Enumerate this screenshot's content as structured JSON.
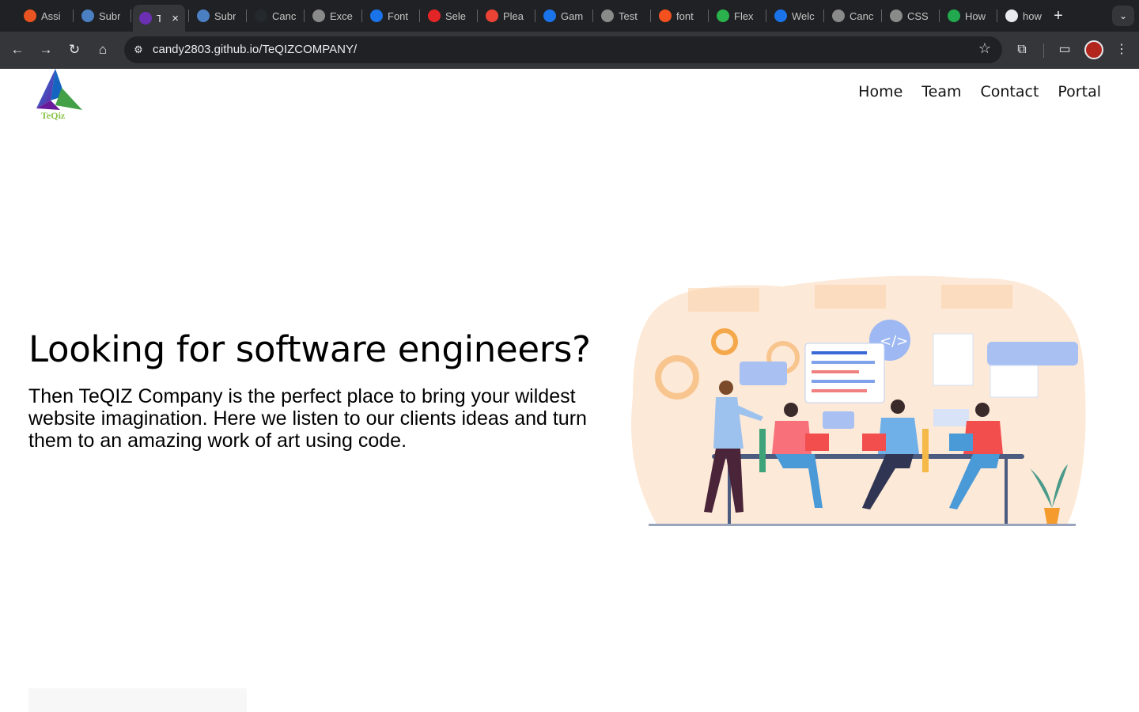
{
  "browser": {
    "tabs": [
      {
        "label": "Assi",
        "icon": "ubuntu-icon",
        "color": "#e95420"
      },
      {
        "label": "Subr",
        "icon": "e-icon",
        "color": "#4a7fc1"
      },
      {
        "label": "T",
        "icon": "teqiz-icon",
        "color": "#6b2fb3",
        "active": true
      },
      {
        "label": "Subr",
        "icon": "e-icon",
        "color": "#4a7fc1"
      },
      {
        "label": "Canc",
        "icon": "github-icon",
        "color": "#24292e"
      },
      {
        "label": "Exce",
        "icon": "globe-icon",
        "color": "#8a8a8a"
      },
      {
        "label": "Font",
        "icon": "flag-icon",
        "color": "#1a73e8"
      },
      {
        "label": "Sele",
        "icon": "zoho-icon",
        "color": "#e42527"
      },
      {
        "label": "Plea",
        "icon": "gmail-icon",
        "color": "#ea4335"
      },
      {
        "label": "Gam",
        "icon": "circle-icon",
        "color": "#1a73e8"
      },
      {
        "label": "Test",
        "icon": "globe-icon",
        "color": "#8a8a8a"
      },
      {
        "label": "font",
        "icon": "code-icon",
        "color": "#f4511e"
      },
      {
        "label": "Flex",
        "icon": "frog-icon",
        "color": "#2bb24c"
      },
      {
        "label": "Welc",
        "icon": "circle-icon",
        "color": "#1a73e8"
      },
      {
        "label": "Canc",
        "icon": "globe-icon",
        "color": "#8a8a8a"
      },
      {
        "label": "CSS",
        "icon": "globe-icon",
        "color": "#8a8a8a"
      },
      {
        "label": "How",
        "icon": "w-icon",
        "color": "#22a94f"
      },
      {
        "label": "how",
        "icon": "chat-icon",
        "color": "#e8eaed"
      }
    ],
    "url": "candy2803.github.io/TeQIZCOMPANY/"
  },
  "site": {
    "logo_text": "TeQiz",
    "nav": [
      "Home",
      "Team",
      "Contact",
      "Portal"
    ],
    "hero_title": "Looking for software engineers?",
    "hero_text": "Then TeQIZ Company is the perfect place to bring your wildest website imagination. Here we listen to our clients ideas and turn them to an amazing work of art using code."
  }
}
